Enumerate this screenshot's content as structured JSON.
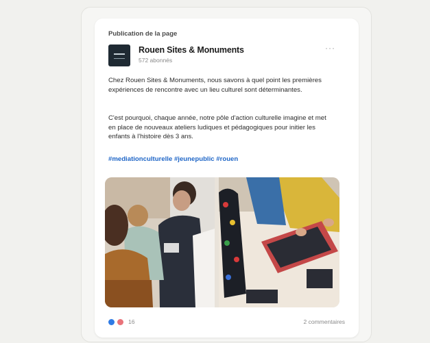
{
  "post": {
    "kicker": "Publication de la page",
    "page_name": "Rouen Sites & Monuments",
    "followers": "572 abonnés",
    "more_icon": "more-horizontal-icon",
    "paragraph_1": "Chez Rouen Sites & Monuments, nous savons à quel point les premières expériences de rencontre avec un lieu culturel sont déterminantes.",
    "paragraph_2": "C'est pourquoi, chaque année, notre pôle d'action culturelle imagine et met en place de nouveaux ateliers ludiques et pédagogiques pour initier les enfants à l'histoire dès 3 ans.",
    "hashtags": "#mediationculturelle #jeunepublic #rouen",
    "reaction_count": "16",
    "comments": "2 commentaires"
  },
  "colors": {
    "page_background": "#f1f1ee",
    "hashtag": "#1f66c7",
    "like": "#2f7be5",
    "love": "#e9737a"
  }
}
